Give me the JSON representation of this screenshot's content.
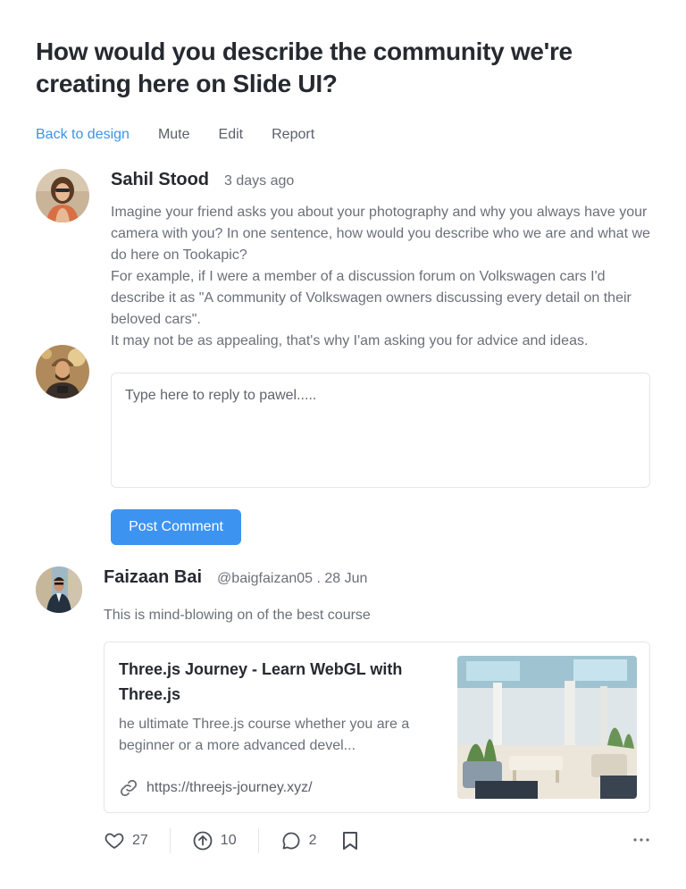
{
  "title": "How would you describe the community we're creating here on Slide UI?",
  "actions": {
    "back": "Back to design",
    "mute": "Mute",
    "edit": "Edit",
    "report": "Report"
  },
  "comment1": {
    "author": "Sahil Stood",
    "time": "3 days ago",
    "lines": [
      "Imagine your friend asks you about your photography and why you always have your camera with you? In one sentence, how would you describe who we are and what we do here on Tookapic?",
      "For example, if I were a member of a discussion forum on Volkswagen cars I'd describe it as \"A community of Volkswagen owners discussing every detail on their beloved cars\".",
      "It may not be as appealing, that's why I'am asking you for advice and ideas."
    ]
  },
  "reply": {
    "placeholder": "Type here to reply to pawel.....",
    "post_label": "Post Comment"
  },
  "comment2": {
    "author": "Faizaan Bai",
    "meta": "@baigfaizan05 . 28 Jun",
    "text": "This is mind-blowing on of the best course",
    "card": {
      "title": "Three.js Journey - Learn WebGL with Three.js",
      "description": "he ultimate Three.js course whether you are a beginner or a more advanced devel...",
      "url": "https://threejs-journey.xyz/"
    },
    "stats": {
      "likes": "27",
      "upvotes": "10",
      "comments": "2"
    }
  },
  "icons": [
    "heart-icon",
    "arrow-up-circle-icon",
    "comment-icon",
    "bookmark-icon",
    "more-icon",
    "link-icon"
  ],
  "colors": {
    "accent": "#3d93f0",
    "link": "#3d93e8",
    "text": "#262a30",
    "muted": "#6b7078"
  }
}
